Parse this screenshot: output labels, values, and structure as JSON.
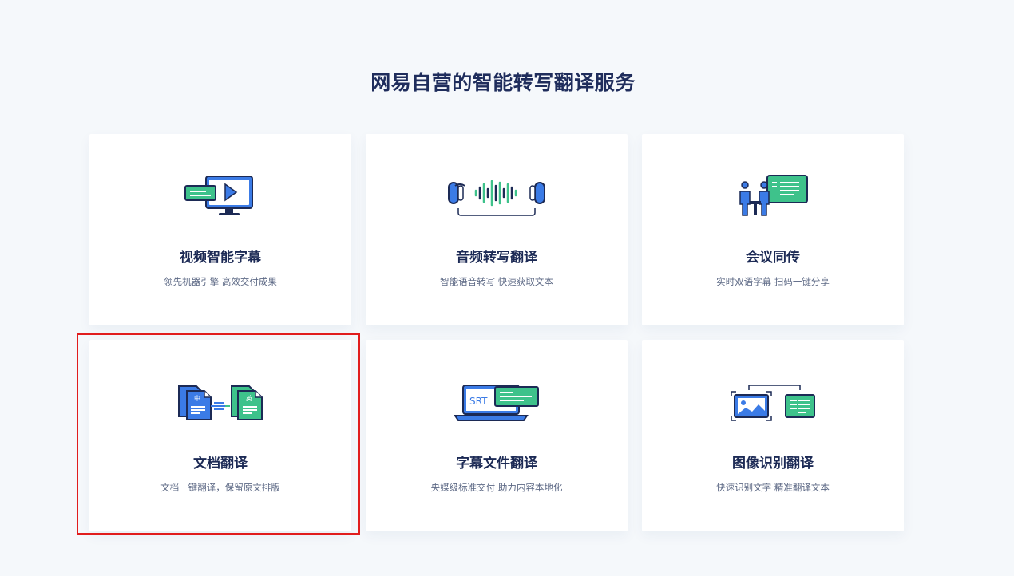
{
  "page": {
    "title": "网易自营的智能转写翻译服务"
  },
  "cards": [
    {
      "title": "视频智能字幕",
      "desc": "领先机器引擎 高效交付成果",
      "icon": "video-subtitle-icon"
    },
    {
      "title": "音频转写翻译",
      "desc": "智能语音转写 快速获取文本",
      "icon": "audio-wave-icon"
    },
    {
      "title": "会议同传",
      "desc": "实时双语字幕 扫码一键分享",
      "icon": "meeting-interpretation-icon"
    },
    {
      "title": "文档翻译",
      "desc": "文档一键翻译，保留原文排版",
      "icon": "document-translate-icon",
      "icon_text": [
        "中",
        "英"
      ],
      "highlighted": true
    },
    {
      "title": "字幕文件翻译",
      "desc": "央媒级标准交付 助力内容本地化",
      "icon": "srt-laptop-icon",
      "icon_text": "SRT"
    },
    {
      "title": "图像识别翻译",
      "desc": "快速识别文字 精准翻译文本",
      "icon": "image-recognition-icon"
    }
  ],
  "colors": {
    "accent_blue": "#3b7be6",
    "accent_green": "#3ec28b",
    "title_navy": "#1f2d5c",
    "highlight_red": "#e11d1d"
  }
}
